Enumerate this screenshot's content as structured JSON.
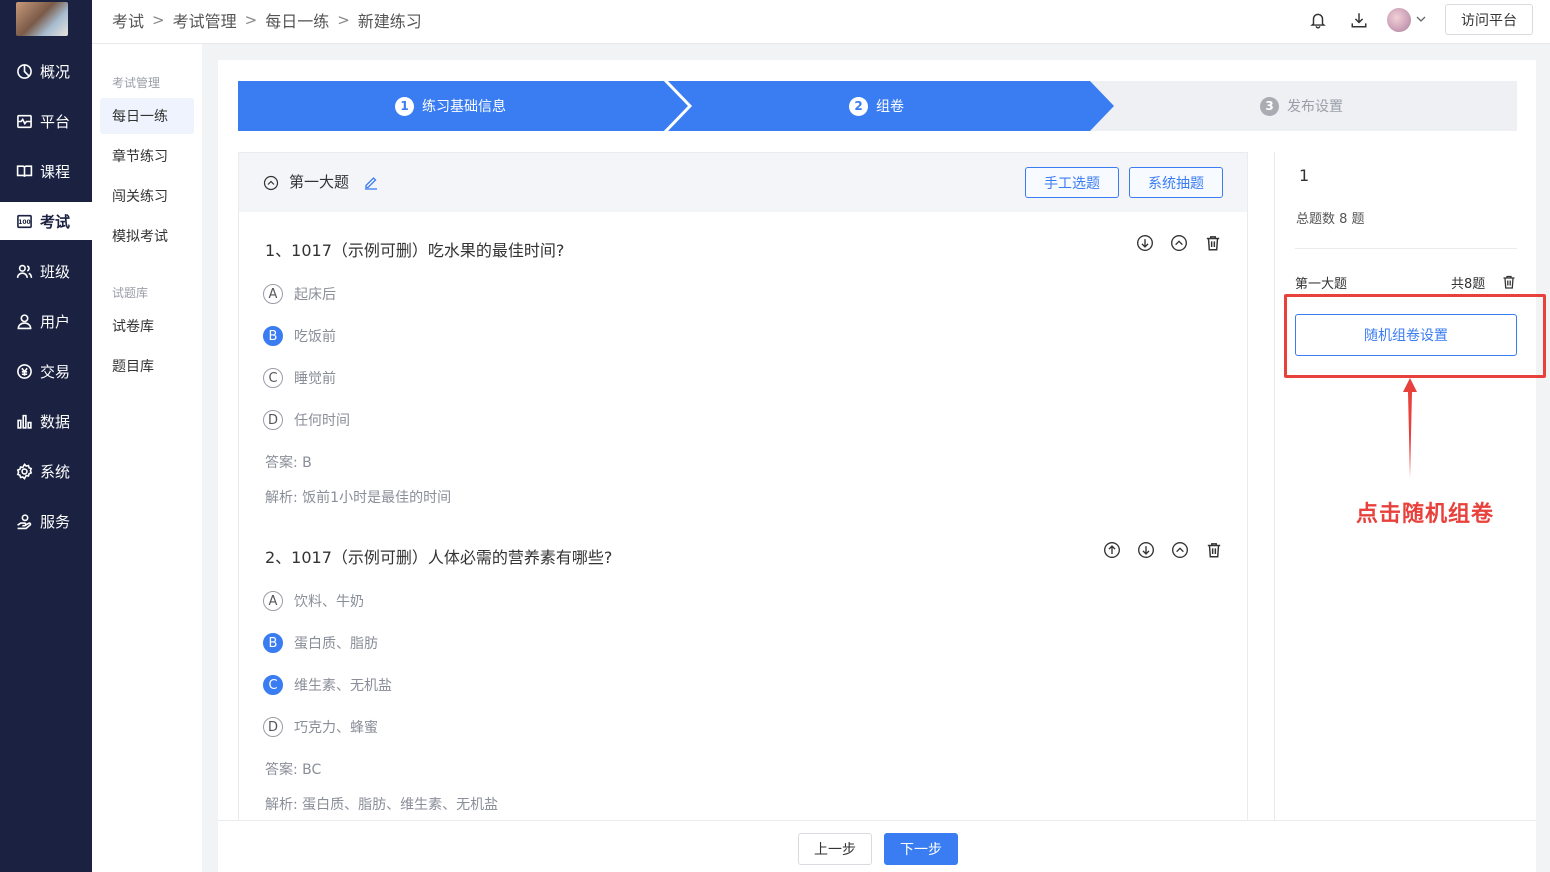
{
  "nav": {
    "items": [
      {
        "label": "概况",
        "icon": "pie-chart-icon"
      },
      {
        "label": "平台",
        "icon": "platform-icon"
      },
      {
        "label": "课程",
        "icon": "book-icon"
      },
      {
        "label": "考试",
        "icon": "exam-icon"
      },
      {
        "label": "班级",
        "icon": "class-icon"
      },
      {
        "label": "用户",
        "icon": "user-icon"
      },
      {
        "label": "交易",
        "icon": "trade-icon"
      },
      {
        "label": "数据",
        "icon": "bar-chart-icon"
      },
      {
        "label": "系统",
        "icon": "gear-icon"
      },
      {
        "label": "服务",
        "icon": "service-icon"
      }
    ],
    "active": "考试"
  },
  "sub": {
    "group1": "考试管理",
    "items1": [
      "每日一练",
      "章节练习",
      "闯关练习",
      "模拟考试"
    ],
    "group2": "试题库",
    "items2": [
      "试卷库",
      "题目库"
    ]
  },
  "breadcrumb": [
    "考试",
    "考试管理",
    "每日一练",
    "新建练习"
  ],
  "header": {
    "visit_label": "访问平台"
  },
  "steps": [
    {
      "num": "1",
      "label": "练习基础信息",
      "state": "active"
    },
    {
      "num": "2",
      "label": "组卷",
      "state": "active"
    },
    {
      "num": "3",
      "label": "发布设置",
      "state": "inactive"
    }
  ],
  "section": {
    "title": "第一大题",
    "manual_label": "手工选题",
    "system_label": "系统抽题"
  },
  "questions": [
    {
      "title": "1、1017（示例可删）吃水果的最佳时间?",
      "options": [
        {
          "letter": "A",
          "text": "起床后",
          "correct": false
        },
        {
          "letter": "B",
          "text": "吃饭前",
          "correct": true
        },
        {
          "letter": "C",
          "text": "睡觉前",
          "correct": false
        },
        {
          "letter": "D",
          "text": "任何时间",
          "correct": false
        }
      ],
      "answer": "答案:  B",
      "analysis": "解析:  饭前1小时是最佳的时间"
    },
    {
      "title": "2、1017（示例可删）人体必需的营养素有哪些?",
      "options": [
        {
          "letter": "A",
          "text": "饮料、牛奶",
          "correct": false
        },
        {
          "letter": "B",
          "text": "蛋白质、脂肪",
          "correct": true
        },
        {
          "letter": "C",
          "text": "维生素、无机盐",
          "correct": true
        },
        {
          "letter": "D",
          "text": "巧克力、蜂蜜",
          "correct": false
        }
      ],
      "answer": "答案:  BC",
      "analysis": "解析:  蛋白质、脂肪、维生素、无机盐"
    }
  ],
  "summary": {
    "count": "1",
    "total": "总题数 8 题",
    "section_name": "第一大题",
    "section_count": "共8题",
    "random_label": "随机组卷设置"
  },
  "footer": {
    "prev_label": "上一步",
    "next_label": "下一步"
  },
  "annotation": {
    "text": "点击随机组卷",
    "color": "#e8413c"
  },
  "colors": {
    "accent": "#3a7cf2",
    "nav_bg": "#1b2241",
    "annotation": "#e8413c"
  }
}
